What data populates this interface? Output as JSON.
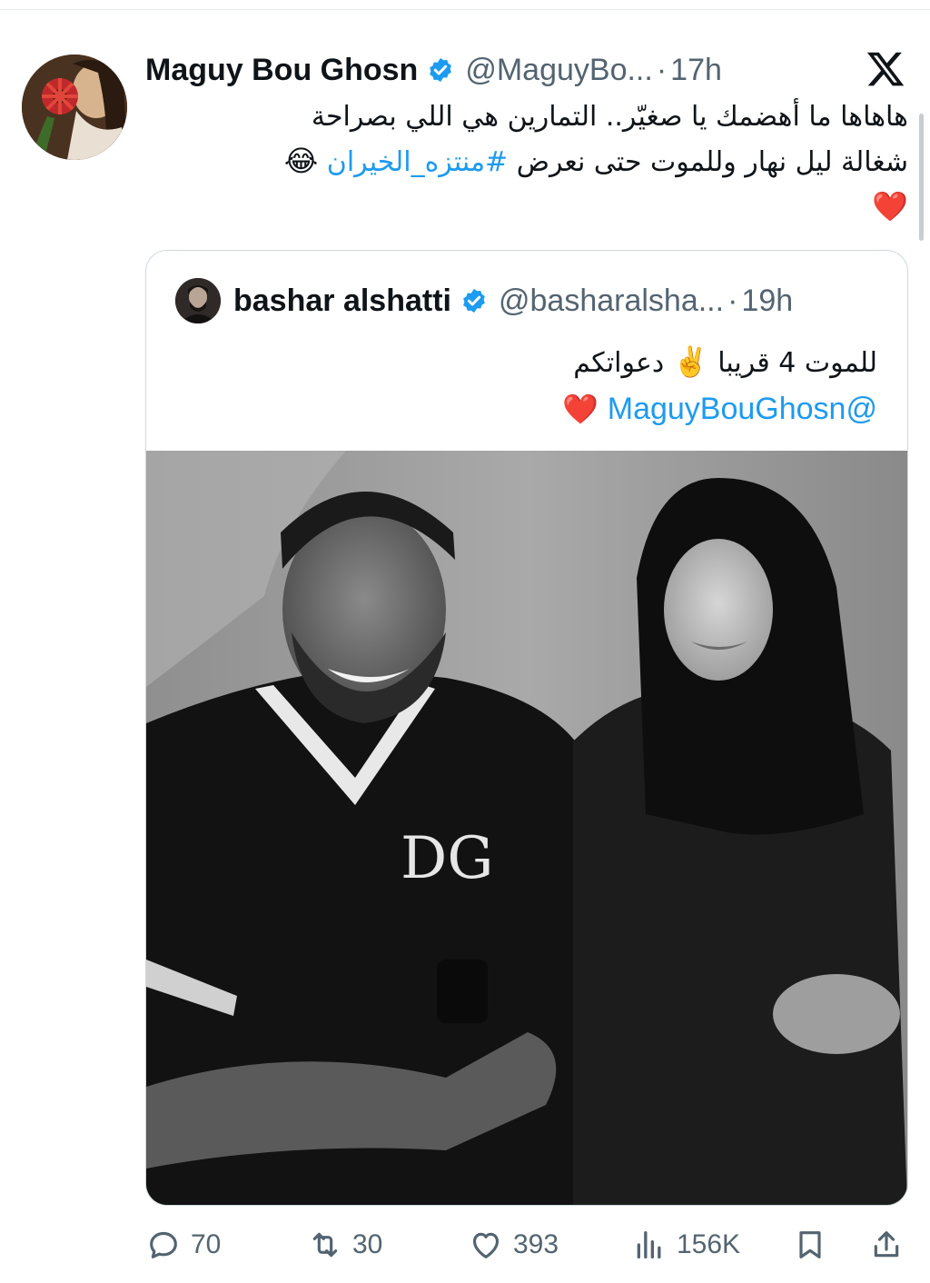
{
  "tweet": {
    "author_name": "Maguy Bou Ghosn",
    "handle": "@MaguyBo...",
    "separator": "·",
    "time": "17h",
    "text_line1": "هاهاها ما أهضمك يا صغيّر.. التمارين هي اللي بصراحة",
    "text_line2_start": "شغالة ليل نهار وللموت حتى نعرض",
    "hashtag": "#منتزه_الخيران",
    "emoji_laugh": "😂",
    "emoji_heart": "❤️"
  },
  "quoted": {
    "author_name": "bashar alshatti",
    "handle": "@basharalsha...",
    "separator": "·",
    "time": "19h",
    "text_line1_a": "للموت 4 قريبا",
    "emoji_victory": "✌️",
    "text_line1_b": "دعواتكم",
    "mention": "@MaguyBouGhosn",
    "emoji_heart": "❤️",
    "photo_print": "DG"
  },
  "actions": {
    "replies": "70",
    "reposts": "30",
    "likes": "393",
    "views": "156K"
  },
  "icons": {
    "verified": "verified-badge-icon",
    "x_logo": "x-logo-icon",
    "reply": "reply-icon",
    "repost": "repost-icon",
    "like": "heart-icon",
    "views": "views-icon",
    "bookmark": "bookmark-icon",
    "share": "share-icon"
  },
  "colors": {
    "link": "#1d9bf0",
    "secondary_text": "#536471",
    "primary_text": "#0f1419",
    "border": "#cfd9de"
  }
}
